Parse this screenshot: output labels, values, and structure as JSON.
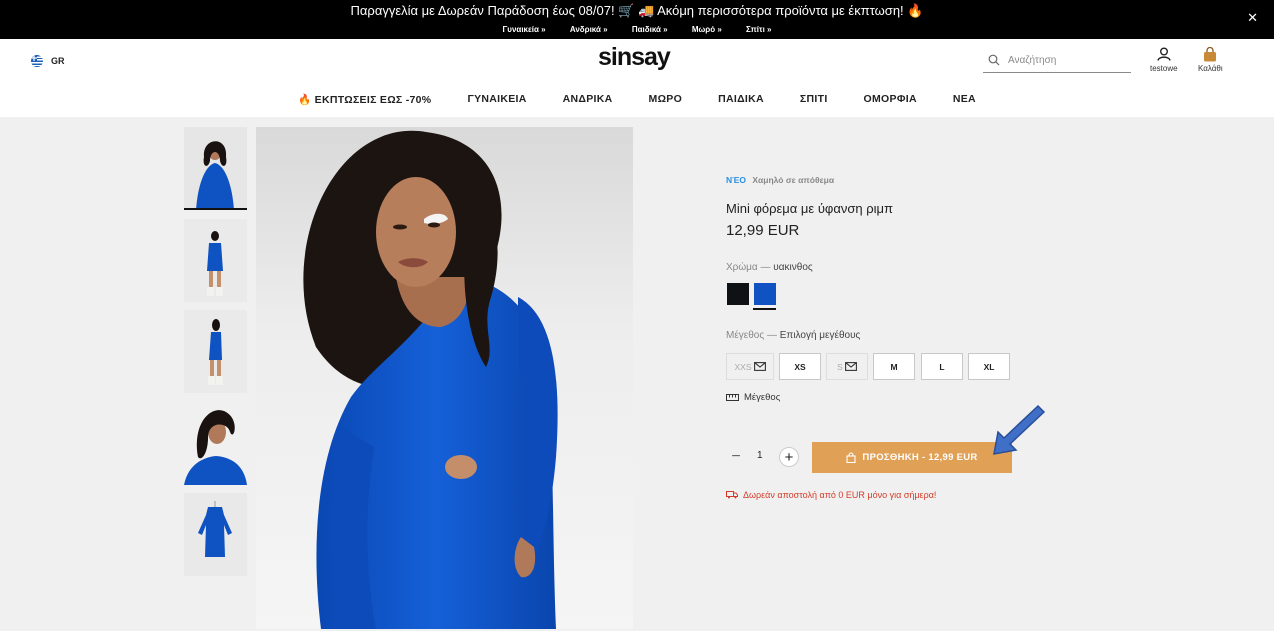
{
  "promo": {
    "text": "Παραγγελία με Δωρεάν Παράδοση έως 08/07! 🛒 🚚 Ακόμη περισσότερα προϊόντα με έκπτωση! 🔥",
    "links": [
      "Γυναικεία »",
      "Ανδρικά »",
      "Παιδικά »",
      "Μωρό »",
      "Σπίτι »"
    ],
    "close": "✕"
  },
  "header": {
    "region": "GR",
    "logo": "sinsay",
    "search_placeholder": "Αναζήτηση",
    "account_label": "testowe",
    "cart_label": "Καλάθι"
  },
  "nav": [
    "🔥 ΕΚΠΤΩΣΕΙΣ ΕΩΣ -70%",
    "ΓΥΝΑΙΚΕΙΑ",
    "ΑΝΔΡΙΚΑ",
    "ΜΩΡΟ",
    "ΠΑΙΔΙΚΑ",
    "ΣΠΙΤΙ",
    "ΟΜΟΡΦΙΑ",
    "ΝΕΑ"
  ],
  "product": {
    "badge_new": "ΝΈΟ",
    "badge_stock": "Χαμηλό σε απόθεμα",
    "title": "Mini φόρεμα με ύφανση ριμπ",
    "price": "12,99 EUR",
    "color_label": "Χρώμα —",
    "color_value": "υακινθος",
    "colors": [
      {
        "name": "black",
        "hex": "#0f1214"
      },
      {
        "name": "blue",
        "hex": "#0f52c2",
        "selected": true
      }
    ],
    "size_label": "Μέγεθος —",
    "size_value": "Επιλογή μεγέθους",
    "sizes": [
      {
        "label": "XXS",
        "available": false
      },
      {
        "label": "XS",
        "available": true
      },
      {
        "label": "S",
        "available": false
      },
      {
        "label": "M",
        "available": true
      },
      {
        "label": "L",
        "available": true
      },
      {
        "label": "XL",
        "available": true
      }
    ],
    "size_guide": "Μέγεθος",
    "quantity": "1",
    "add_to_cart": "ΠΡΟΣΘΗΚΗ - 12,99 EUR",
    "shipping": "Δωρεάν αποστολή από 0 EUR μόνο για σήμερα!"
  },
  "colors": {
    "accent_button": "#e0a055",
    "badge_new": "#2a8fe0",
    "shipping_text": "#d43c2a",
    "dress_blue": "#0f52c2"
  }
}
